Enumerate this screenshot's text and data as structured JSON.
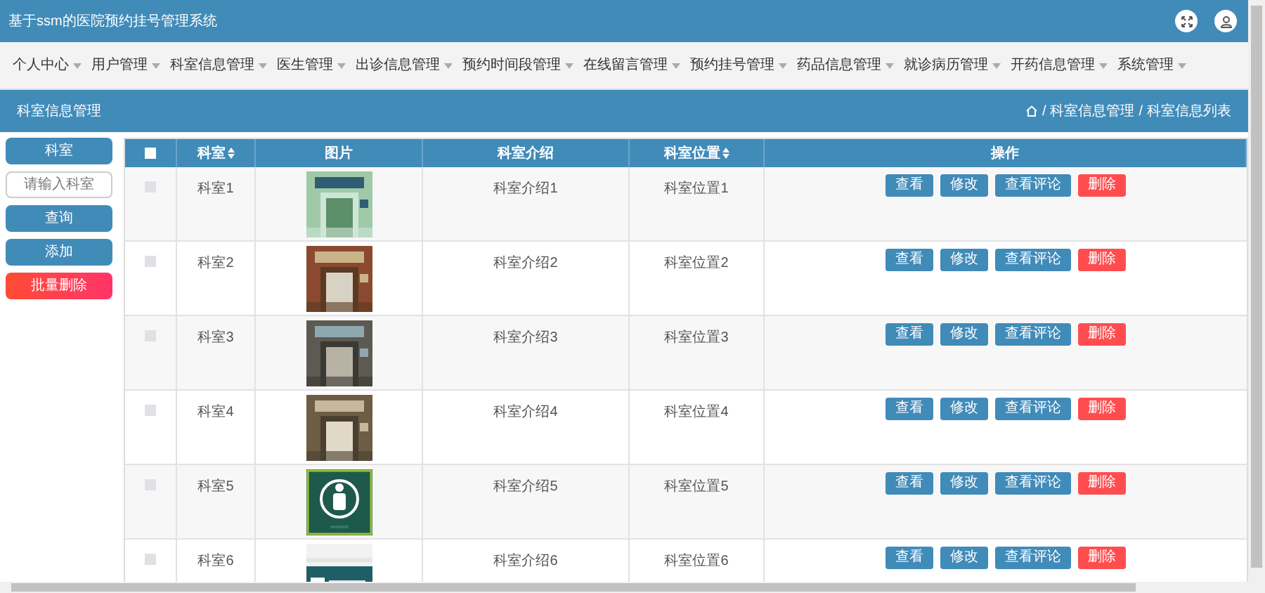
{
  "header": {
    "title": "基于ssm的医院预约挂号管理系统"
  },
  "nav": [
    {
      "label": "个人中心"
    },
    {
      "label": "用户管理"
    },
    {
      "label": "科室信息管理"
    },
    {
      "label": "医生管理"
    },
    {
      "label": "出诊信息管理"
    },
    {
      "label": "预约时间段管理"
    },
    {
      "label": "在线留言管理"
    },
    {
      "label": "预约挂号管理"
    },
    {
      "label": "药品信息管理"
    },
    {
      "label": "就诊病历管理"
    },
    {
      "label": "开药信息管理"
    },
    {
      "label": "系统管理"
    }
  ],
  "page_bar": {
    "title": "科室信息管理",
    "separator": "/",
    "breadcrumb": [
      "科室信息管理",
      "科室信息列表"
    ]
  },
  "sidebar": {
    "field_label": "科室",
    "search": {
      "placeholder": "请输入科室"
    },
    "buttons": [
      {
        "label": "查询",
        "kind": "primary"
      },
      {
        "label": "添加",
        "kind": "primary"
      },
      {
        "label": "批量删除",
        "kind": "danger"
      }
    ]
  },
  "table": {
    "all_checked": false,
    "columns": [
      {
        "label": "科室",
        "sortable": true
      },
      {
        "label": "图片",
        "sortable": false
      },
      {
        "label": "科室介绍",
        "sortable": false
      },
      {
        "label": "科室位置",
        "sortable": true
      },
      {
        "label": "操作",
        "sortable": false
      }
    ],
    "rows": [
      {
        "checked": false,
        "name": "科室1",
        "intro": "科室介绍1",
        "location": "科室位置1",
        "actions": [
          {
            "label": "查看",
            "kind": "primary"
          },
          {
            "label": "修改",
            "kind": "primary"
          },
          {
            "label": "查看评论",
            "kind": "primary"
          },
          {
            "label": "删除",
            "kind": "danger"
          }
        ]
      },
      {
        "checked": false,
        "name": "科室2",
        "intro": "科室介绍2",
        "location": "科室位置2",
        "actions": [
          {
            "label": "查看",
            "kind": "primary"
          },
          {
            "label": "修改",
            "kind": "primary"
          },
          {
            "label": "查看评论",
            "kind": "primary"
          },
          {
            "label": "删除",
            "kind": "danger"
          }
        ]
      },
      {
        "checked": false,
        "name": "科室3",
        "intro": "科室介绍3",
        "location": "科室位置3",
        "actions": [
          {
            "label": "查看",
            "kind": "primary"
          },
          {
            "label": "修改",
            "kind": "primary"
          },
          {
            "label": "查看评论",
            "kind": "primary"
          },
          {
            "label": "删除",
            "kind": "danger"
          }
        ]
      },
      {
        "checked": false,
        "name": "科室4",
        "intro": "科室介绍4",
        "location": "科室位置4",
        "actions": [
          {
            "label": "查看",
            "kind": "primary"
          },
          {
            "label": "修改",
            "kind": "primary"
          },
          {
            "label": "查看评论",
            "kind": "primary"
          },
          {
            "label": "删除",
            "kind": "danger"
          }
        ]
      },
      {
        "checked": false,
        "name": "科室5",
        "intro": "科室介绍5",
        "location": "科室位置5",
        "actions": [
          {
            "label": "查看",
            "kind": "primary"
          },
          {
            "label": "修改",
            "kind": "primary"
          },
          {
            "label": "查看评论",
            "kind": "primary"
          },
          {
            "label": "删除",
            "kind": "danger"
          }
        ]
      },
      {
        "checked": false,
        "name": "科室6",
        "intro": "科室介绍6",
        "location": "科室位置6",
        "actions": [
          {
            "label": "查看",
            "kind": "primary"
          },
          {
            "label": "修改",
            "kind": "primary"
          },
          {
            "label": "查看评论",
            "kind": "primary"
          },
          {
            "label": "删除",
            "kind": "danger"
          }
        ]
      }
    ]
  }
}
